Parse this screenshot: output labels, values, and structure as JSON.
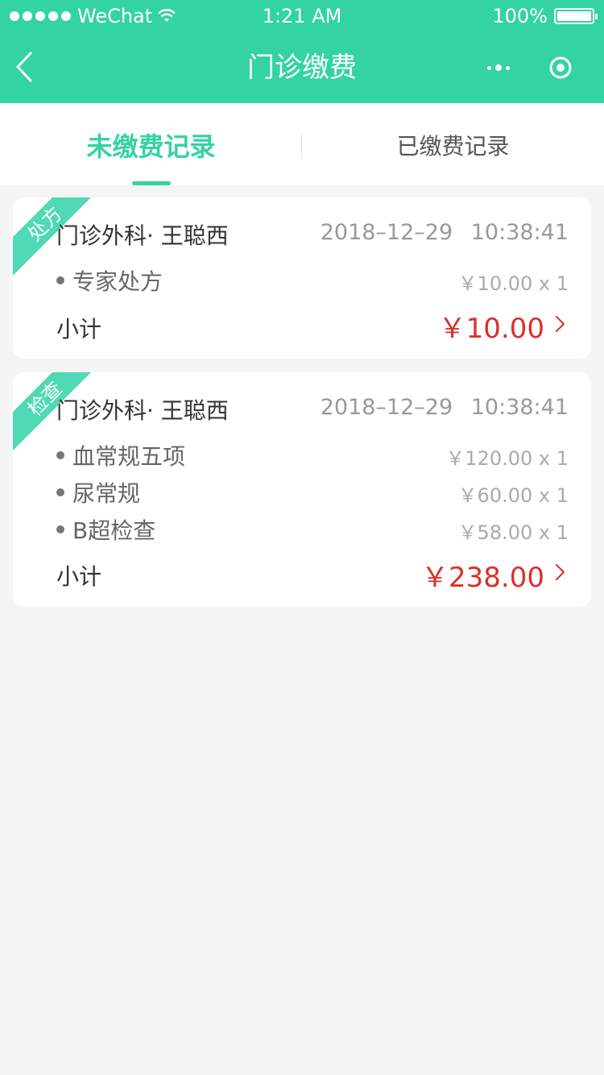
{
  "status_bar": {
    "carrier": "WeChat",
    "time": "1:21 AM",
    "battery": "100%"
  },
  "navbar": {
    "title": "门诊缴费"
  },
  "tabs": [
    {
      "label": "未缴费记录",
      "active": true
    },
    {
      "label": "已缴费记录",
      "active": false
    }
  ],
  "records": [
    {
      "tag": "处方",
      "department": "门诊外科· 王聪西",
      "datetime": "2018–12–29 10:38:41",
      "items": [
        {
          "name": "专家处方",
          "price": "￥10.00 x 1"
        }
      ],
      "subtotal_label": "小计",
      "subtotal": "￥10.00"
    },
    {
      "tag": "检查",
      "department": "门诊外科· 王聪西",
      "datetime": "2018–12–29 10:38:41",
      "items": [
        {
          "name": "血常规五项",
          "price": "￥120.00 x 1"
        },
        {
          "name": "尿常规",
          "price": "￥60.00 x 1"
        },
        {
          "name": "B超检查",
          "price": "￥58.00 x 1"
        }
      ],
      "subtotal_label": "小计",
      "subtotal": "￥238.00"
    }
  ],
  "colors": {
    "brand": "#34d3a2",
    "price": "#d9302a"
  }
}
